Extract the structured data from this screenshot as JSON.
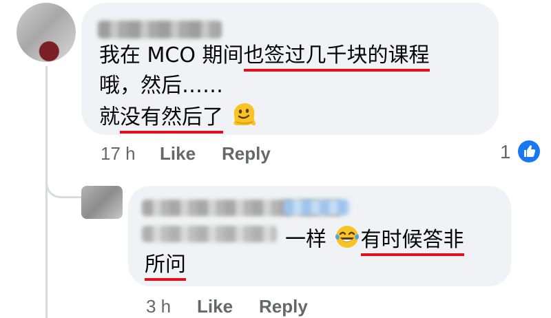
{
  "comment": {
    "line1_prefix": "我在 MCO 期间",
    "line1_underlined": "也签过几千块的课程",
    "line2": "哦，然后……",
    "line3_first": "就",
    "line3_underlined": "没有然后了",
    "emoji_icon": "melting-face-icon",
    "time": "17 h",
    "like_label": "Like",
    "reply_label": "Reply",
    "reaction_count": "1",
    "reaction_icon": "like-thumbs-up-icon"
  },
  "reply": {
    "text_part1": "一样",
    "emoji_icon": "tears-of-joy-icon",
    "text_underlined_line1": "有时候答非",
    "text_underlined_line2": "所问",
    "time": "3 h",
    "like_label": "Like",
    "reply_label": "Reply"
  },
  "colors": {
    "bubble_bg": "#f0f2f5",
    "underline": "#e0101d",
    "meta_text": "#65676b",
    "like_blue": "#1877f2"
  }
}
